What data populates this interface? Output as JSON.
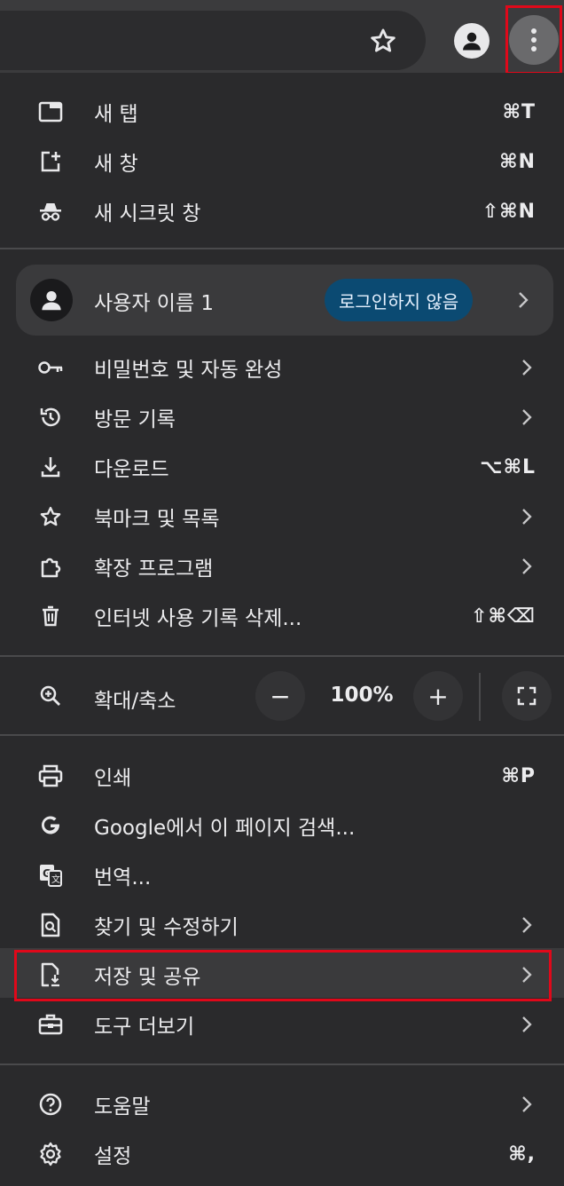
{
  "toolbar": {
    "star_icon": "star-icon",
    "profile_icon": "person-icon",
    "menu_icon": "three-dots-vertical-icon"
  },
  "menu": {
    "group1": [
      {
        "label": "새 탭",
        "shortcut": "⌘T",
        "icon": "new-tab-icon"
      },
      {
        "label": "새 창",
        "shortcut": "⌘N",
        "icon": "new-window-icon"
      },
      {
        "label": "새 시크릿 창",
        "shortcut": "⇧⌘N",
        "icon": "incognito-icon"
      }
    ],
    "profile": {
      "name": "사용자 이름 1",
      "status": "로그인하지 않음",
      "icon": "avatar-icon"
    },
    "group2": [
      {
        "label": "비밀번호 및 자동 완성",
        "icon": "key-icon"
      },
      {
        "label": "방문 기록",
        "icon": "history-icon"
      },
      {
        "label": "다운로드",
        "shortcut": "⌥⌘L",
        "icon": "download-icon"
      },
      {
        "label": "북마크 및 목록",
        "icon": "star-icon"
      },
      {
        "label": "확장 프로그램",
        "icon": "puzzle-icon"
      },
      {
        "label": "인터넷 사용 기록 삭제...",
        "shortcut": "⇧⌘⌫",
        "icon": "trash-icon"
      }
    ],
    "zoom": {
      "label": "확대/축소",
      "minus": "−",
      "value": "100%",
      "plus": "+"
    },
    "group3": [
      {
        "label": "인쇄",
        "shortcut": "⌘P",
        "icon": "print-icon"
      },
      {
        "label": "Google에서 이 페이지 검색...",
        "icon": "google-icon"
      },
      {
        "label": "번역...",
        "icon": "translate-icon"
      },
      {
        "label": "찾기 및 수정하기",
        "icon": "find-page-icon"
      },
      {
        "label": "저장 및 공유",
        "icon": "save-share-icon"
      },
      {
        "label": "도구 더보기",
        "icon": "toolbox-icon"
      }
    ],
    "group4": [
      {
        "label": "도움말",
        "icon": "help-icon"
      },
      {
        "label": "설정",
        "shortcut": "⌘,",
        "icon": "gear-icon"
      }
    ]
  },
  "colors": {
    "background": "#2a2a2c",
    "highlight_border": "#e0081a",
    "badge_bg": "#0b4a72"
  }
}
